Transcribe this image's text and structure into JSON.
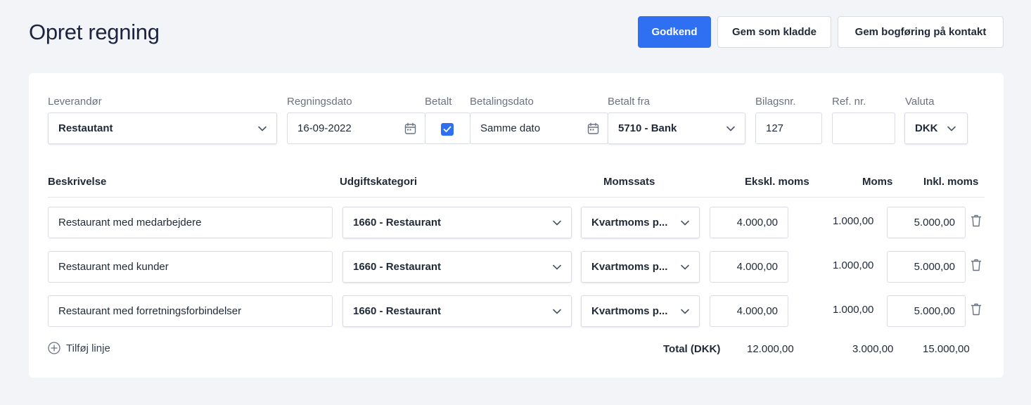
{
  "page": {
    "title": "Opret regning"
  },
  "actions": {
    "approve": "Godkend",
    "save_draft": "Gem som kladde",
    "save_contact": "Gem bogføring på kontakt"
  },
  "header_fields": {
    "supplier": {
      "label": "Leverandør",
      "value": "Restautant"
    },
    "invoice_date": {
      "label": "Regningsdato",
      "value": "16-09-2022"
    },
    "paid": {
      "label": "Betalt",
      "checked": true
    },
    "payment_date": {
      "label": "Betalingsdato",
      "value": "Samme dato"
    },
    "paid_from": {
      "label": "Betalt fra",
      "value": "5710 - Bank"
    },
    "voucher_no": {
      "label": "Bilagsnr.",
      "value": "127"
    },
    "ref_no": {
      "label": "Ref. nr.",
      "value": ""
    },
    "currency": {
      "label": "Valuta",
      "value": "DKK"
    }
  },
  "columns": {
    "description": "Beskrivelse",
    "category": "Udgiftskategori",
    "vat_rate": "Momssats",
    "excl_vat": "Ekskl. moms",
    "vat": "Moms",
    "incl_vat": "Inkl. moms"
  },
  "lines": [
    {
      "description": "Restaurant med medarbejdere",
      "category": "1660 - Restaurant",
      "vat_rate": "Kvartmoms p...",
      "excl_vat": "4.000,00",
      "vat": "1.000,00",
      "incl_vat": "5.000,00"
    },
    {
      "description": "Restaurant med kunder",
      "category": "1660 - Restaurant",
      "vat_rate": "Kvartmoms p...",
      "excl_vat": "4.000,00",
      "vat": "1.000,00",
      "incl_vat": "5.000,00"
    },
    {
      "description": "Restaurant med forretningsforbindelser",
      "category": "1660 - Restaurant",
      "vat_rate": "Kvartmoms p...",
      "excl_vat": "4.000,00",
      "vat": "1.000,00",
      "incl_vat": "5.000,00"
    }
  ],
  "add_line": "Tilføj linje",
  "totals": {
    "label": "Total (DKK)",
    "excl_vat": "12.000,00",
    "vat": "3.000,00",
    "incl_vat": "15.000,00"
  },
  "icons": {
    "dropdown": "chevron-down-icon",
    "date": "calendar-icon",
    "checkbox": "checkmark-icon",
    "delete": "trash-icon",
    "add": "plus-circle-icon"
  },
  "colors": {
    "primary": "#2f6ff2",
    "background": "#f3f4f8",
    "title": "#1b2340"
  }
}
